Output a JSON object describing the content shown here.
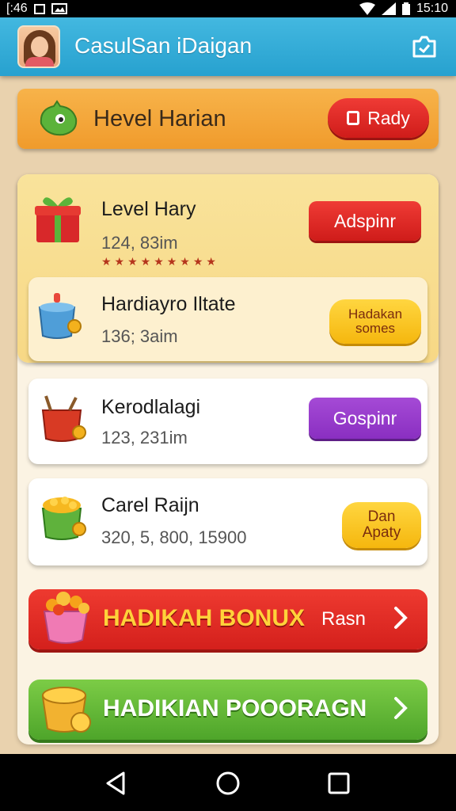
{
  "status_bar": {
    "time_left": "[:46",
    "time_right": "15:10"
  },
  "app_bar": {
    "title": "CasulSan iDaigan"
  },
  "banner": {
    "title": "Hevel Harian",
    "button_label": "Rady"
  },
  "rows": [
    {
      "name": "Level Hary",
      "sub": "124, 83im",
      "button_label": "Adspinr",
      "button_style": "red",
      "stars": "★★★★★★★★★"
    },
    {
      "name": "Hardiayro Iltate",
      "sub": "136; 3aim",
      "button_label": "Hadakan\nsomes",
      "button_style": "yellow"
    },
    {
      "name": "Kerodlalagi",
      "sub": "123, 231im",
      "button_label": "Gospinr",
      "button_style": "purple"
    },
    {
      "name": "Carel Raijn",
      "sub": "320, 5, 800, 15900",
      "button_label": "Dan\nApaty",
      "button_style": "yellow"
    }
  ],
  "bonus_red": {
    "label": "HADIKAH BONUX",
    "extra": "Rasn"
  },
  "bonus_green": {
    "label": "HADIKIAN POOORAGN"
  },
  "colors": {
    "app_bar": "#2ea7d4",
    "banner": "#f4a93c",
    "red": "#e0271f",
    "purple": "#9a3fcf",
    "yellow": "#fbcb27",
    "green": "#5fb634"
  }
}
